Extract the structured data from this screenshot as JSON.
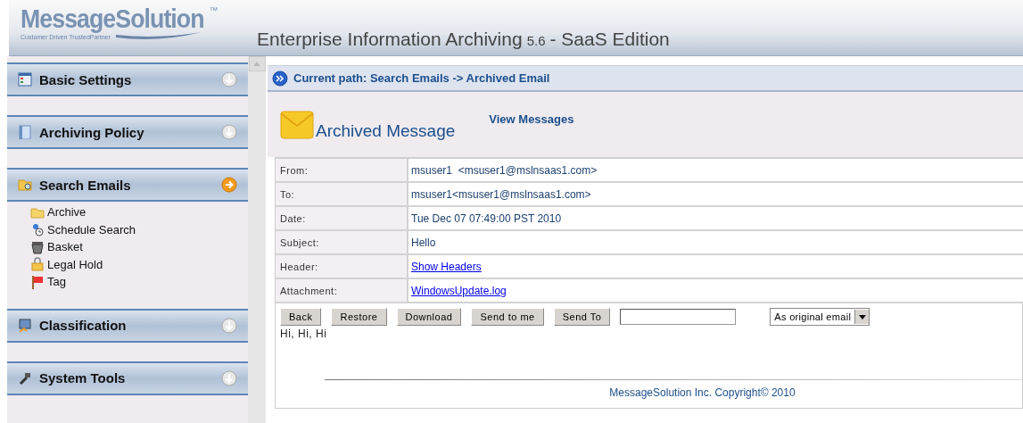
{
  "logo": {
    "name": "MessageSolution",
    "trademark": "™",
    "tagline": "Customer Driven TrustedPartner"
  },
  "header": {
    "title": "Enterprise Information Archiving",
    "version": "5.6",
    "edition": "- SaaS Edition"
  },
  "sidebar": {
    "sections": [
      {
        "title": "Basic Settings",
        "kind": "settings",
        "expanded": false
      },
      {
        "title": "Archiving Policy",
        "kind": "book",
        "expanded": false
      },
      {
        "title": "Search Emails",
        "kind": "search",
        "expanded": true,
        "items": [
          {
            "label": "Archive",
            "kind": "folder"
          },
          {
            "label": "Schedule Search",
            "kind": "clock"
          },
          {
            "label": "Basket",
            "kind": "basket"
          },
          {
            "label": "Legal Hold",
            "kind": "lock"
          },
          {
            "label": "Tag",
            "kind": "flag"
          }
        ]
      },
      {
        "title": "Classification",
        "kind": "monitor",
        "expanded": false
      },
      {
        "title": "System Tools",
        "kind": "tools",
        "expanded": false
      }
    ]
  },
  "path": {
    "text": "Current path: Search Emails -> Archived Email"
  },
  "message": {
    "title": "Archived Message",
    "link": "View Messages",
    "fields": [
      {
        "label": "From:",
        "value": "msuser1  <msuser1@mslnsaas1.com>",
        "kind": "text"
      },
      {
        "label": "To:",
        "value": "msuser1<msuser1@mslnsaas1.com>",
        "kind": "text"
      },
      {
        "label": "Date:",
        "value": "Tue Dec 07 07:49:00 PST 2010",
        "kind": "text"
      },
      {
        "label": "Subject:",
        "value": "Hello",
        "kind": "text"
      },
      {
        "label": "Header:",
        "value": "Show Headers",
        "kind": "link"
      },
      {
        "label": "Attachment:",
        "value": "WindowsUpdate.log",
        "kind": "link"
      }
    ],
    "buttons": [
      "Back",
      "Restore",
      "Download",
      "Send to me",
      "Send To"
    ],
    "send_format": "As original email",
    "body": "Hi, Hi, Hi"
  },
  "footer": {
    "copyright": "MessageSolution Inc. Copyright© 2010"
  }
}
